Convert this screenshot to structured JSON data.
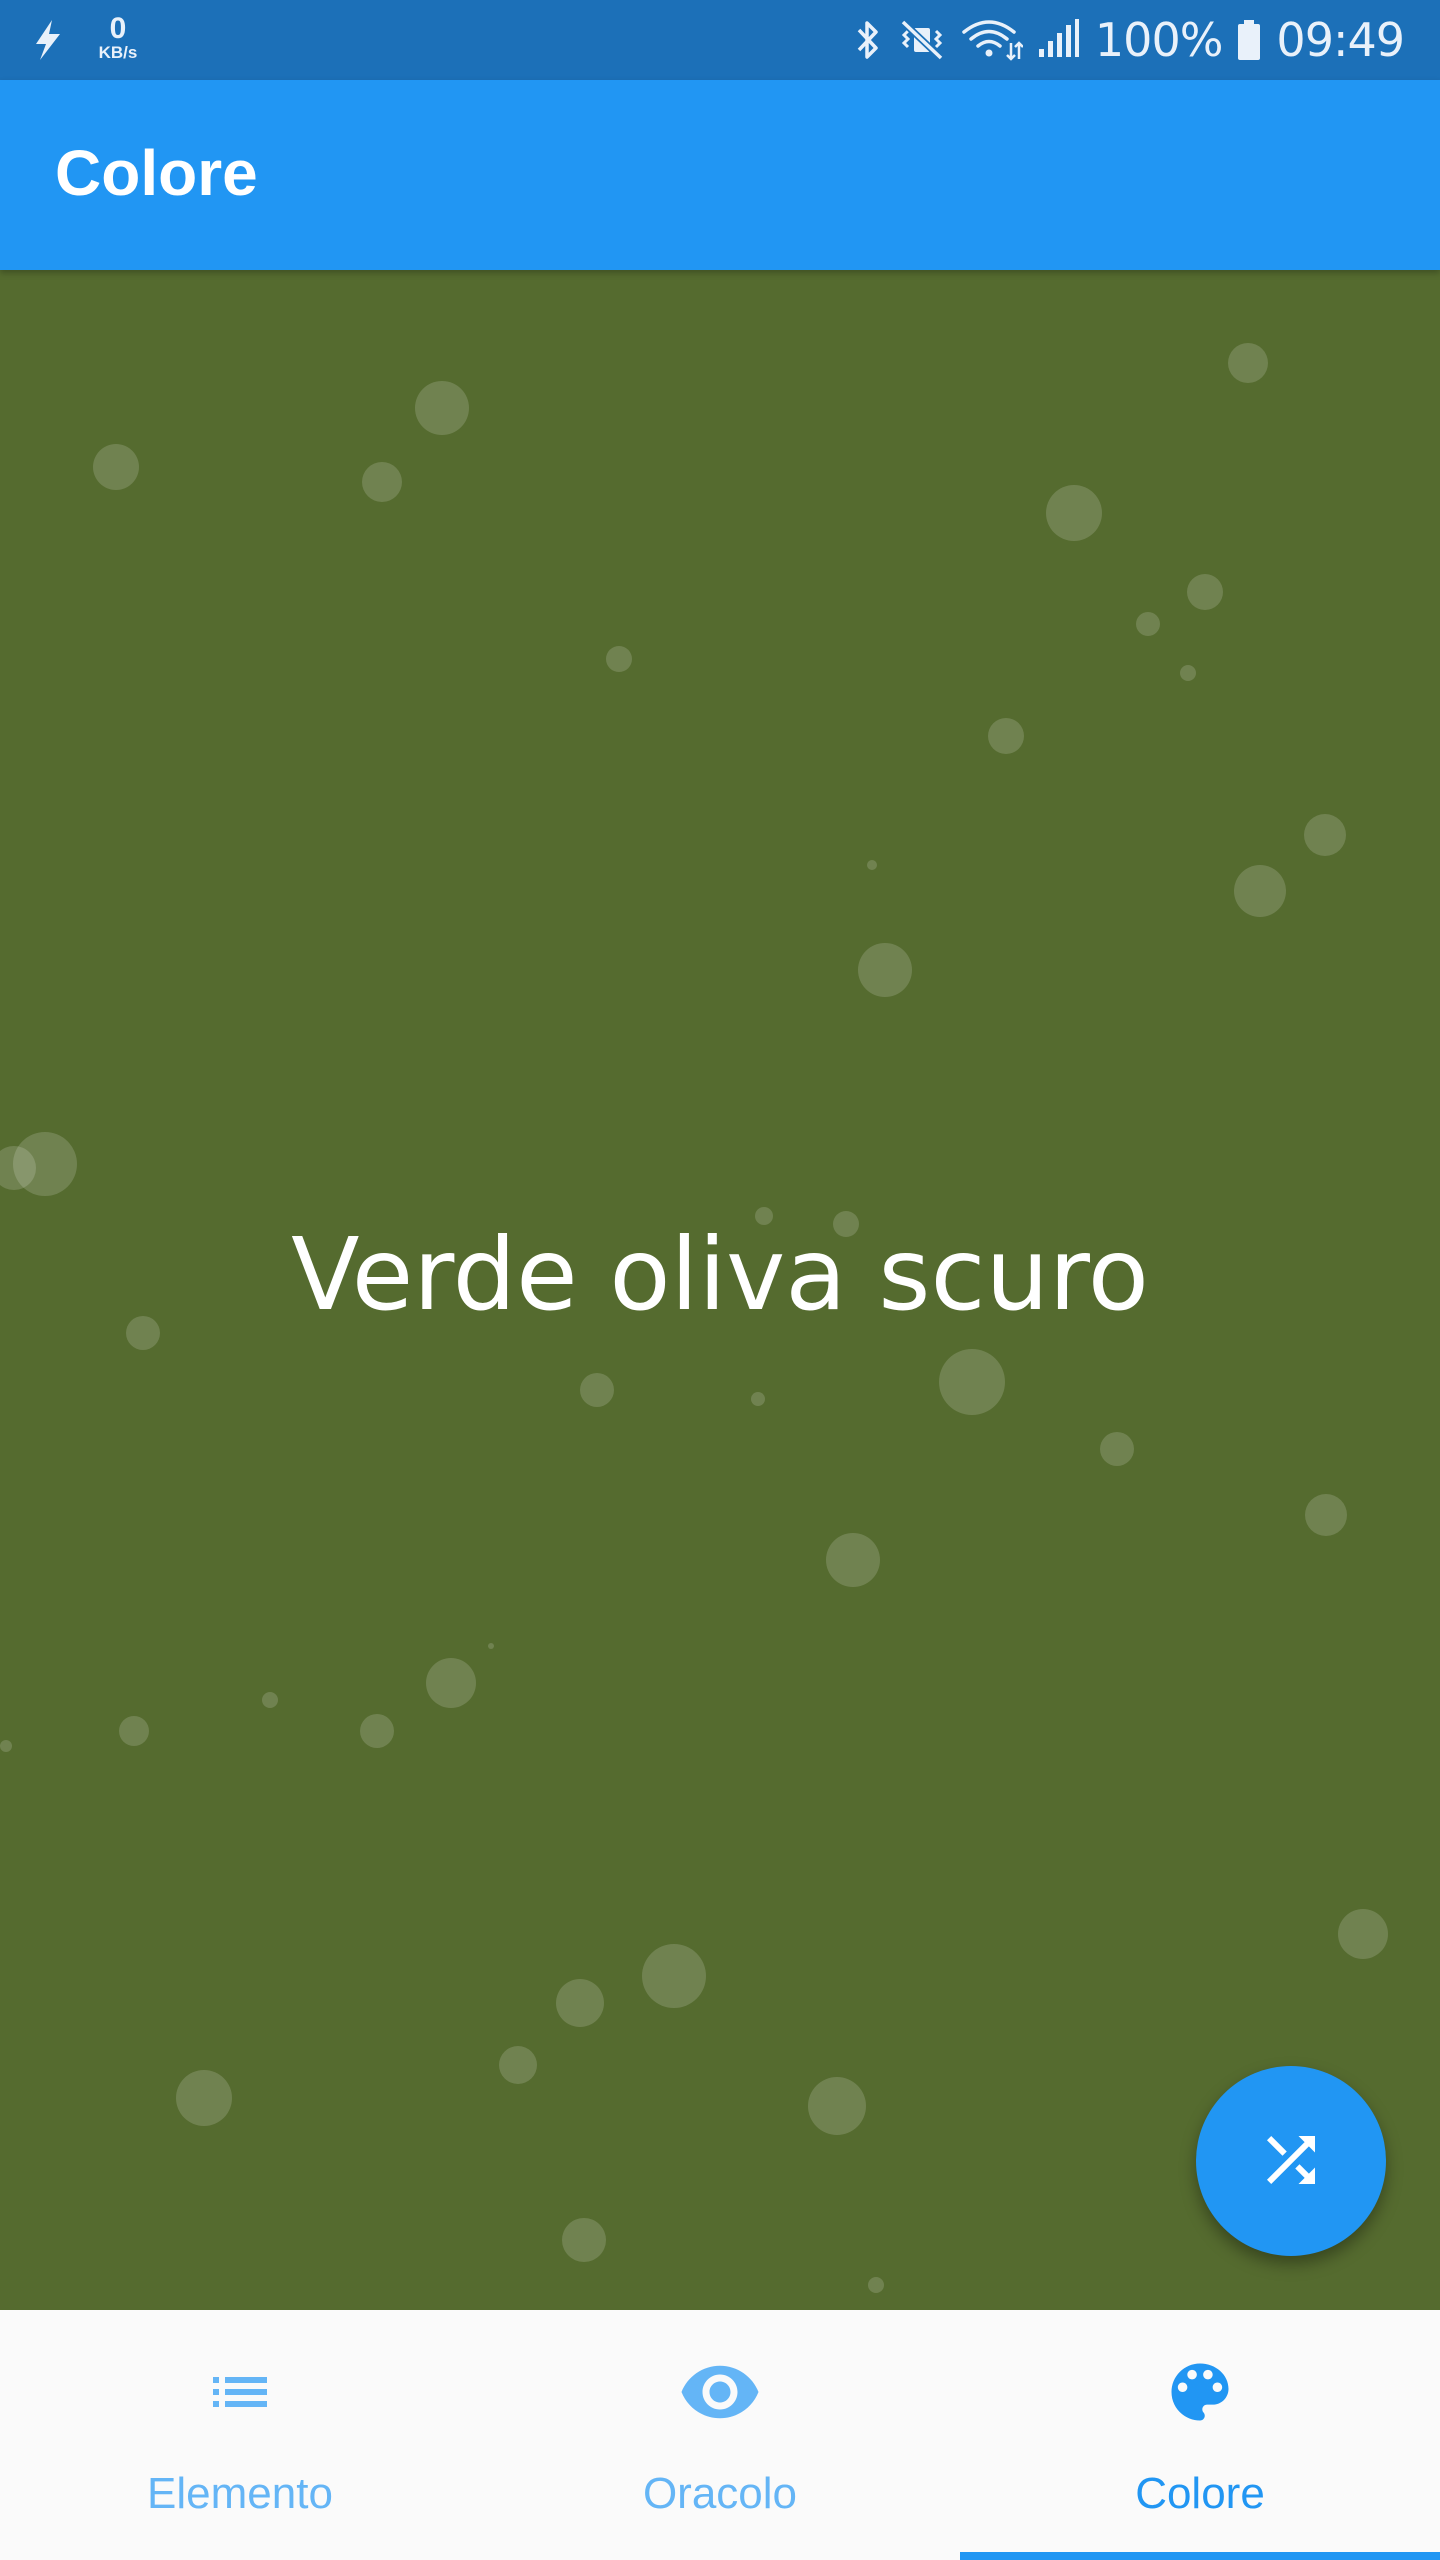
{
  "status_bar": {
    "net_speed_value": "0",
    "net_speed_unit": "KB/s",
    "battery": "100%",
    "time": "09:49",
    "icons": [
      "lightning-icon",
      "bluetooth-icon",
      "mute-vibrate-icon",
      "wifi-icon",
      "signal-icon",
      "battery-icon"
    ]
  },
  "app_bar": {
    "title": "Colore"
  },
  "content": {
    "color_name": "Verde oliva scuro",
    "background_color": "#556b2f"
  },
  "fab": {
    "icon": "shuffle-icon"
  },
  "bottom_nav": {
    "items": [
      {
        "label": "Elemento",
        "icon": "list-icon",
        "active": false
      },
      {
        "label": "Oracolo",
        "icon": "eye-icon",
        "active": false
      },
      {
        "label": "Colore",
        "icon": "palette-icon",
        "active": true
      }
    ]
  },
  "colors": {
    "primary": "#2196f3",
    "status_bar": "#1c70b8",
    "inactive_nav": "#64b5f6",
    "nav_background": "#fafafa"
  }
}
